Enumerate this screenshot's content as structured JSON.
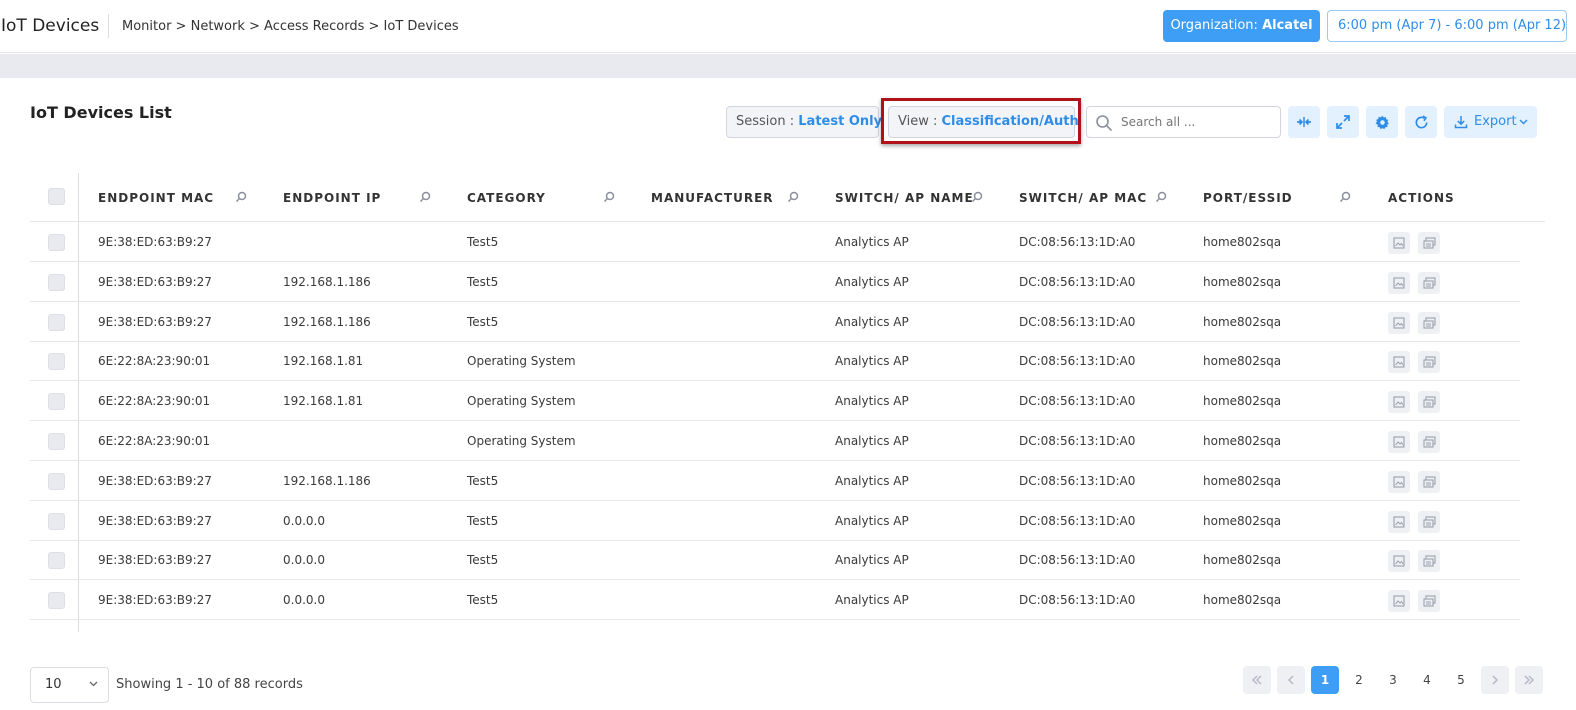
{
  "header": {
    "title": "IoT Devices",
    "breadcrumb": [
      "Monitor",
      "Network",
      "Access Records",
      "IoT Devices"
    ],
    "org_label": "Organization:",
    "org_value": "Alcatel",
    "date_range": "6:00 pm (Apr 7) - 6:00 pm (Apr 12)"
  },
  "list": {
    "title": "IoT Devices List",
    "session_label": "Session :",
    "session_value": "Latest Only",
    "view_label": "View :",
    "view_value": "Classification/Auth",
    "search_placeholder": "Search all ...",
    "export_label": "Export"
  },
  "table": {
    "columns": [
      "ENDPOINT MAC",
      "ENDPOINT IP",
      "CATEGORY",
      "MANUFACTURER",
      "SWITCH/ AP NAME",
      "SWITCH/ AP MAC",
      "PORT/ESSID",
      "ACTIONS"
    ],
    "rows": [
      {
        "mac": "9E:38:ED:63:B9:27",
        "ip": "",
        "category": "Test5",
        "manufacturer": "",
        "ap_name": "Analytics AP",
        "ap_mac": "DC:08:56:13:1D:A0",
        "port": "home802sqa"
      },
      {
        "mac": "9E:38:ED:63:B9:27",
        "ip": "192.168.1.186",
        "category": "Test5",
        "manufacturer": "",
        "ap_name": "Analytics AP",
        "ap_mac": "DC:08:56:13:1D:A0",
        "port": "home802sqa"
      },
      {
        "mac": "9E:38:ED:63:B9:27",
        "ip": "192.168.1.186",
        "category": "Test5",
        "manufacturer": "",
        "ap_name": "Analytics AP",
        "ap_mac": "DC:08:56:13:1D:A0",
        "port": "home802sqa"
      },
      {
        "mac": "6E:22:8A:23:90:01",
        "ip": "192.168.1.81",
        "category": "Operating System",
        "manufacturer": "",
        "ap_name": "Analytics AP",
        "ap_mac": "DC:08:56:13:1D:A0",
        "port": "home802sqa"
      },
      {
        "mac": "6E:22:8A:23:90:01",
        "ip": "192.168.1.81",
        "category": "Operating System",
        "manufacturer": "",
        "ap_name": "Analytics AP",
        "ap_mac": "DC:08:56:13:1D:A0",
        "port": "home802sqa"
      },
      {
        "mac": "6E:22:8A:23:90:01",
        "ip": "",
        "category": "Operating System",
        "manufacturer": "",
        "ap_name": "Analytics AP",
        "ap_mac": "DC:08:56:13:1D:A0",
        "port": "home802sqa"
      },
      {
        "mac": "9E:38:ED:63:B9:27",
        "ip": "192.168.1.186",
        "category": "Test5",
        "manufacturer": "",
        "ap_name": "Analytics AP",
        "ap_mac": "DC:08:56:13:1D:A0",
        "port": "home802sqa"
      },
      {
        "mac": "9E:38:ED:63:B9:27",
        "ip": "0.0.0.0",
        "category": "Test5",
        "manufacturer": "",
        "ap_name": "Analytics AP",
        "ap_mac": "DC:08:56:13:1D:A0",
        "port": "home802sqa"
      },
      {
        "mac": "9E:38:ED:63:B9:27",
        "ip": "0.0.0.0",
        "category": "Test5",
        "manufacturer": "",
        "ap_name": "Analytics AP",
        "ap_mac": "DC:08:56:13:1D:A0",
        "port": "home802sqa"
      },
      {
        "mac": "9E:38:ED:63:B9:27",
        "ip": "0.0.0.0",
        "category": "Test5",
        "manufacturer": "",
        "ap_name": "Analytics AP",
        "ap_mac": "DC:08:56:13:1D:A0",
        "port": "home802sqa"
      }
    ]
  },
  "footer": {
    "page_size": "10",
    "records_text": "Showing 1 - 10 of 88 records",
    "pages": [
      "1",
      "2",
      "3",
      "4",
      "5"
    ],
    "current_page": "1"
  },
  "colors": {
    "accent": "#3e9df5",
    "highlight_border": "#b0121a",
    "link_text": "#2f8de8"
  },
  "icons": [
    "search-icon",
    "compress-icon",
    "expand-icon",
    "gear-icon",
    "refresh-icon",
    "download-icon",
    "chevron-down-icon",
    "column-search-icon",
    "view-icon",
    "copy-icon",
    "first-page-icon",
    "prev-page-icon",
    "next-page-icon",
    "last-page-icon"
  ]
}
